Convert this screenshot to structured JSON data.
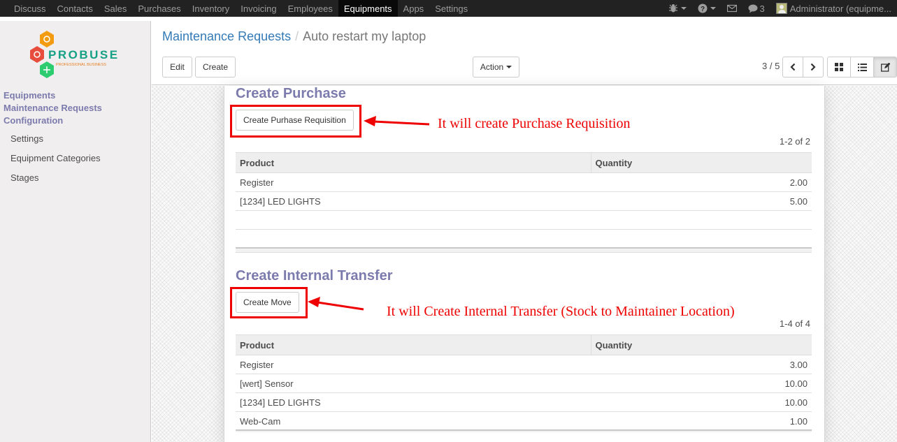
{
  "topbar": {
    "menu": [
      {
        "label": "Discuss",
        "active": false
      },
      {
        "label": "Contacts",
        "active": false
      },
      {
        "label": "Sales",
        "active": false
      },
      {
        "label": "Purchases",
        "active": false
      },
      {
        "label": "Inventory",
        "active": false
      },
      {
        "label": "Invoicing",
        "active": false
      },
      {
        "label": "Employees",
        "active": false
      },
      {
        "label": "Equipments",
        "active": true
      },
      {
        "label": "Apps",
        "active": false
      },
      {
        "label": "Settings",
        "active": false
      }
    ],
    "messages_count": "3",
    "user": "Administrator (equipme..."
  },
  "sidebar": {
    "logo": {
      "brand": "PROBUSE",
      "tagline": "PROFESSIONAL BUSINESS"
    },
    "main_items": [
      "Equipments",
      "Maintenance Requests",
      "Configuration"
    ],
    "sub_items": [
      "Settings",
      "Equipment Categories",
      "Stages"
    ]
  },
  "control_panel": {
    "breadcrumb_parent": "Maintenance Requests",
    "breadcrumb_sep": "/",
    "breadcrumb_current": "Auto restart my laptop",
    "edit_label": "Edit",
    "create_label": "Create",
    "action_label": "Action",
    "pager": "3 / 5"
  },
  "purchase": {
    "title": "Create Purchase",
    "button_label": "Create Purhase Requisition",
    "annotation": "It will create Purchase Requisition",
    "counter": "1-2 of 2",
    "col_product": "Product",
    "col_quantity": "Quantity",
    "rows": [
      {
        "product": "Register",
        "quantity": "2.00"
      },
      {
        "product": "[1234] LED LIGHTS",
        "quantity": "5.00"
      }
    ]
  },
  "transfer": {
    "title": "Create Internal Transfer",
    "button_label": "Create Move",
    "annotation": "It will Create Internal Transfer (Stock to Maintainer Location)",
    "counter": "1-4 of 4",
    "col_product": "Product",
    "col_quantity": "Quantity",
    "rows": [
      {
        "product": "Register",
        "quantity": "3.00"
      },
      {
        "product": "[wert] Sensor",
        "quantity": "10.00"
      },
      {
        "product": "[1234] LED LIGHTS",
        "quantity": "10.00"
      },
      {
        "product": "Web-Cam",
        "quantity": "1.00"
      }
    ]
  },
  "colors": {
    "accent": "#7c7bad",
    "annotation": "#ee0000",
    "link": "#337ab7"
  }
}
